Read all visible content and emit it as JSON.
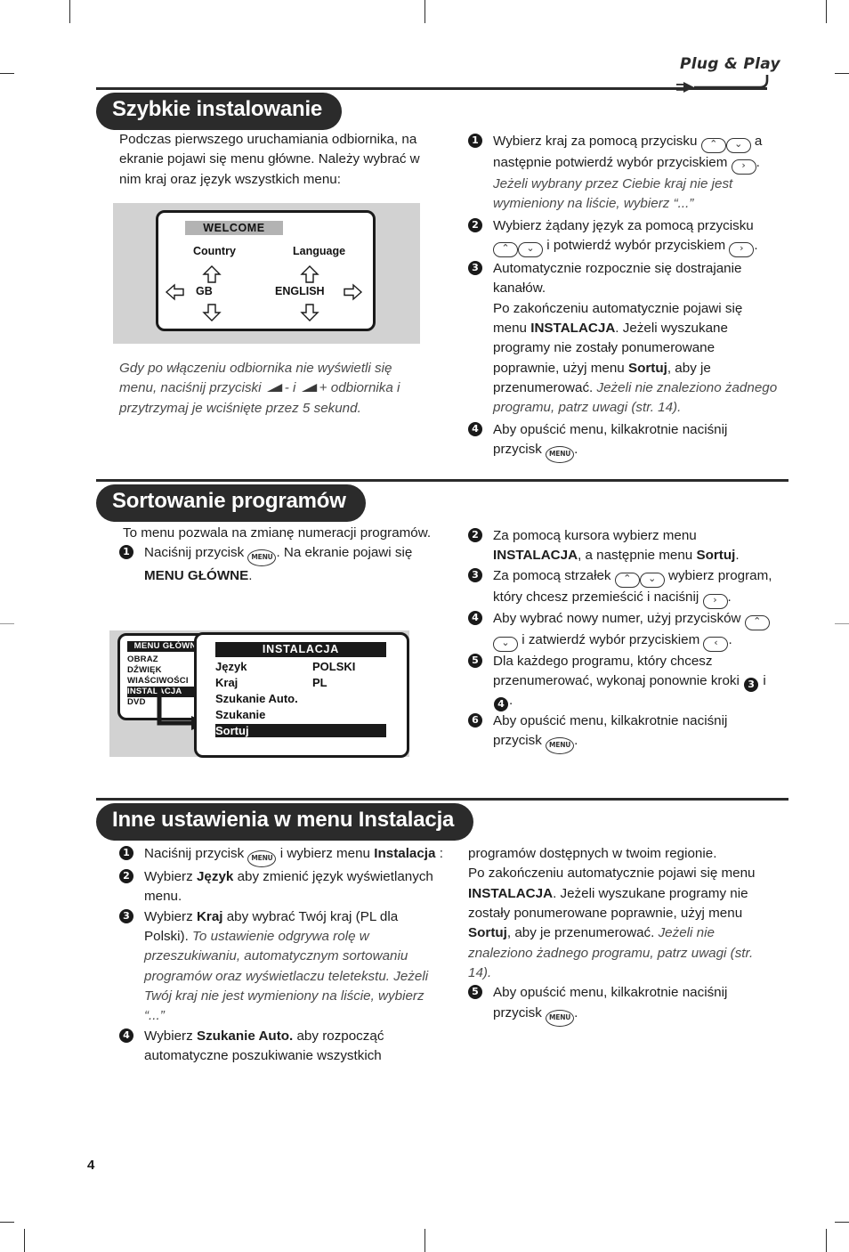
{
  "document": {
    "page_number": "4",
    "brand_logo": "Plug & Play"
  },
  "sections": [
    {
      "id": "szybkie-instalowanie",
      "title": "Szybkie instalowanie",
      "left": {
        "intro": "Podczas pierwszego uruchamiania odbiornika, na ekranie pojawi się menu główne. Należy wybrać w nim kraj oraz język wszystkich menu:",
        "note": "Gdy po włączeniu odbiornika nie wyświetli się menu, naciśnij przyciski",
        "note_mid": "- i",
        "note_end": "+ odbiornika i przytrzymaj je wciśnięte przez 5 sekund."
      },
      "figure": {
        "title": "WELCOME",
        "col1_label": "Country",
        "col1_value": "GB",
        "col2_label": "Language",
        "col2_value": "ENGLISH"
      },
      "steps": [
        {
          "num": "1",
          "text_a": "Wybierz kraj za pomocą przycisku",
          "keys": [
            "up",
            "down"
          ],
          "text_b": "a następnie potwierdź wybór przyciskiem",
          "key_b": "right",
          "text_c": ".",
          "italic": "Jeżeli wybrany przez Ciebie kraj nie jest wymieniony na liście, wybierz “...”"
        },
        {
          "num": "2",
          "text_a": "Wybierz żądany język za pomocą przycisku",
          "keys": [
            "up",
            "down"
          ],
          "text_b": "i potwierdź wybór przyciskiem",
          "key_b": "right",
          "text_c": "."
        },
        {
          "num": "3",
          "text_a": "Automatycznie rozpocznie się dostrajanie kanałów.",
          "text_b": "Po zakończeniu automatycznie pojawi się menu",
          "bold_1": "INSTALACJA",
          "text_c": ". Jeżeli wyszukane programy nie zostały ponumerowane poprawnie, użyj menu",
          "bold_2": "Sortuj",
          "text_d": ", aby je przenumerować.",
          "italic": "Jeżeli nie znaleziono żadnego programu, patrz uwagi (str. 14)."
        },
        {
          "num": "4",
          "text_a": "Aby opuścić menu, kilkakrotnie naciśnij przycisk",
          "key_b": "menu",
          "text_c": "."
        }
      ]
    },
    {
      "id": "sortowanie-programow",
      "title": "Sortowanie programów",
      "left": {
        "intro": "To menu pozwala na zmianę numeracji programów.",
        "step1_num": "1",
        "step1_a": "Naciśnij przycisk",
        "step1_key": "menu",
        "step1_b": ". Na ekranie pojawi się",
        "step1_bold": "MENU GŁÓWNE",
        "step1_c": "."
      },
      "figure": {
        "main_menu_title": "MENU GŁÓWNE",
        "main_menu_items": [
          "OBRAZ",
          "DŹWIĘK",
          "WIAŚCIWOŚCI",
          "INSTALACJA",
          "DVD"
        ],
        "main_menu_selected": "INSTALACJA",
        "panel_title": "INSTALACJA",
        "panel_rows": [
          {
            "label": "Język",
            "value": "POLSKI"
          },
          {
            "label": "Kraj",
            "value": "PL"
          },
          {
            "label": "Szukanie Auto.",
            "value": ""
          },
          {
            "label": "Szukanie",
            "value": ""
          },
          {
            "label": "Sortuj",
            "value": ""
          }
        ],
        "panel_selected": "Sortuj"
      },
      "steps": [
        {
          "num": "2",
          "text_a": "Za pomocą kursora wybierz menu",
          "bold_1": "INSTALACJA",
          "text_b": ", a następnie menu",
          "bold_2": "Sortuj",
          "text_c": "."
        },
        {
          "num": "3",
          "text_a": "Za pomocą strzałek",
          "keys": [
            "up",
            "down"
          ],
          "text_b": "wybierz program, który chcesz przemieścić i naciśnij",
          "key_b": "right",
          "text_c": "."
        },
        {
          "num": "4",
          "text_a": "Aby wybrać nowy numer, użyj przycisków",
          "keys": [
            "up",
            "down"
          ],
          "text_b": "i zatwierdź wybór przyciskiem",
          "key_b": "left",
          "text_c": "."
        },
        {
          "num": "5",
          "text_a": "Dla każdego programu, który chcesz przenumerować, wykonaj ponownie kroki",
          "ref_1": "3",
          "text_b": "i",
          "ref_2": "4",
          "text_c": "."
        },
        {
          "num": "6",
          "text_a": "Aby opuścić menu, kilkakrotnie naciśnij przycisk",
          "key_b": "menu",
          "text_c": "."
        }
      ]
    },
    {
      "id": "inne-ustawienia",
      "title": "Inne ustawienia w menu Instalacja",
      "steps_left": [
        {
          "num": "1",
          "text_a": "Naciśnij przycisk",
          "key_b": "menu",
          "text_b": "i wybierz menu",
          "bold_1": "Instalacja",
          "text_c": ":"
        },
        {
          "num": "2",
          "text_a": "Wybierz",
          "bold_1": "Język",
          "text_b": "aby zmienić język wyświetlanych menu."
        },
        {
          "num": "3",
          "text_a": "Wybierz",
          "bold_1": "Kraj",
          "text_b": "aby wybrać Twój kraj (PL dla Polski).",
          "italic": "To ustawienie odgrywa rolę w przeszukiwaniu, automatycznym sortowaniu programów oraz wyświetlaczu teletekstu. Jeżeli Twój kraj nie jest wymieniony na liście, wybierz “...”"
        },
        {
          "num": "4",
          "text_a": "Wybierz",
          "bold_1": "Szukanie Auto.",
          "text_b": "aby rozpocząć automatyczne poszukiwanie wszystkich"
        }
      ],
      "right": {
        "cont_a": "programów dostępnych w twoim regionie.",
        "cont_b": "Po zakończeniu automatycznie pojawi się menu",
        "bold_1": "INSTALACJA",
        "cont_c": ". Jeżeli wyszukane programy nie zostały ponumerowane poprawnie, użyj menu",
        "bold_2": "Sortuj",
        "cont_d": ", aby je przenumerować.",
        "italic": "Jeżeli nie znaleziono żadnego programu, patrz uwagi (str. 14).",
        "step5_num": "5",
        "step5_a": "Aby opuścić menu, kilkakrotnie naciśnij przycisk",
        "step5_key": "menu",
        "step5_b": "."
      }
    }
  ],
  "icons": {
    "up": "⌃",
    "down": "⌄",
    "left": "‹",
    "right": "›",
    "menu": "MENU"
  },
  "colors": {
    "ink": "#1a1a1a",
    "figure_bg": "#d2d2d2",
    "osd_header": "#b3b3b3"
  }
}
